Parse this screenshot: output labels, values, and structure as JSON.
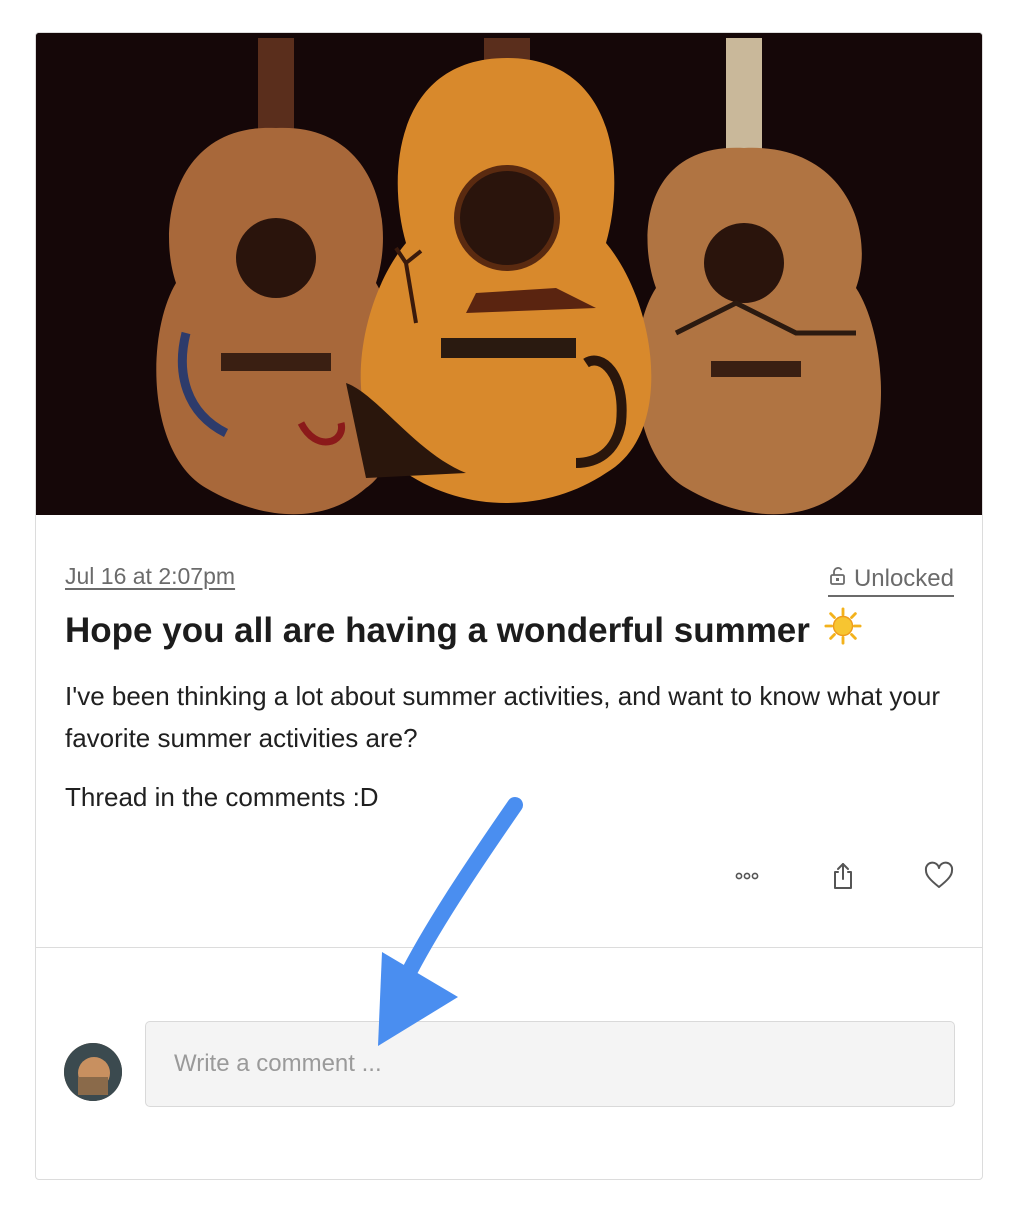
{
  "post": {
    "date": "Jul 16 at 2:07pm",
    "lock_status": "Unlocked",
    "title": "Hope you all are having a wonderful summer",
    "title_emoji": "sun",
    "body": [
      "I've been thinking a lot about summer activities, and want to know what your favorite summer activities are?",
      "Thread in the comments :D"
    ]
  },
  "actions": [
    {
      "icon": "more-options-icon"
    },
    {
      "icon": "share-icon"
    },
    {
      "icon": "heart-icon"
    }
  ],
  "comment": {
    "placeholder": "Write a comment ..."
  },
  "colors": {
    "annotation_arrow": "#4a8ef0",
    "meta_text": "#6b6b6b",
    "input_bg": "#f4f4f4"
  }
}
